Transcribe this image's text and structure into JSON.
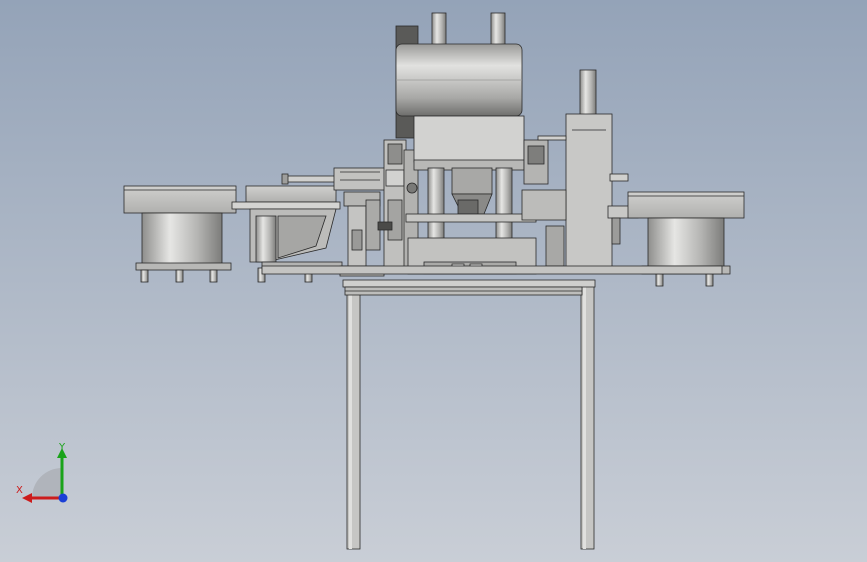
{
  "viewport": {
    "background_top": "#94a3b8",
    "background_bottom": "#c9ced6"
  },
  "model": {
    "metal_color": "#c8c8c6",
    "edge_color": "#2a2a2a"
  },
  "triad": {
    "x_label": "X",
    "y_label": "Y",
    "x_color": "#cc1c1c",
    "y_color": "#1aa31a",
    "z_color": "#1a3fd6"
  }
}
